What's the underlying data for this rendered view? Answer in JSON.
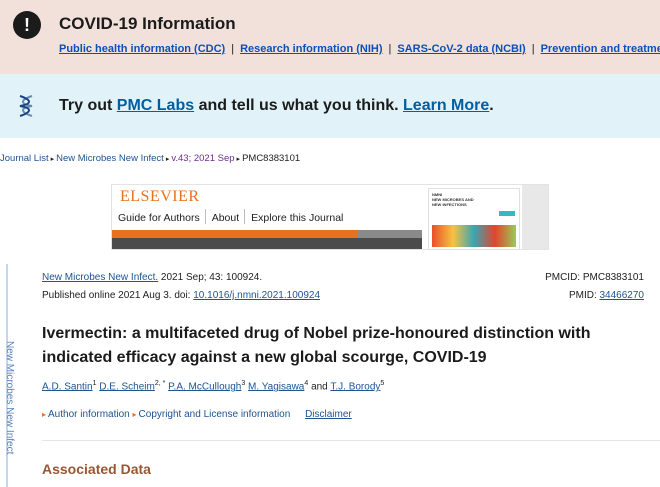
{
  "covid": {
    "title": "COVID-19 Information",
    "links": [
      "Public health information (CDC)",
      "Research information (NIH)",
      "SARS-CoV-2 data (NCBI)",
      "Prevention and treatment"
    ],
    "separator": "|"
  },
  "labs": {
    "prefix": "Try out ",
    "link": "PMC Labs",
    "middle": " and tell us what you think. ",
    "learn_more": "Learn More",
    "suffix": "."
  },
  "breadcrumb": {
    "items": [
      "Journal List",
      "New Microbes New Infect",
      "v.43; 2021 Sep",
      "PMC8383101"
    ]
  },
  "journal_banner": {
    "publisher": "ELSEVIER",
    "nav": [
      "Guide for Authors",
      "About",
      "Explore this Journal"
    ],
    "cover_text": "NMNI\nNEW MICROBES AND\nNEW INFECTIONS"
  },
  "side_tab": "New Microbes New Infect",
  "article": {
    "journal_link": "New Microbes New Infect.",
    "citation": " 2021 Sep; 43: 100924.",
    "published": "Published online 2021 Aug 3. doi: ",
    "doi": "10.1016/j.nmni.2021.100924",
    "pmcid": "PMCID: PMC8383101",
    "pmid_label": "PMID: ",
    "pmid": "34466270",
    "title": "Ivermectin: a multifaceted drug of Nobel prize-honoured distinction with indicated efficacy against a new global scourge, COVID-19",
    "authors": [
      {
        "name": "A.D. Santin",
        "sup": "1"
      },
      {
        "name": "D.E. Scheim",
        "sup": "2, *"
      },
      {
        "name": "P.A. McCullough",
        "sup": "3"
      },
      {
        "name": "M. Yagisawa",
        "sup": "4"
      },
      {
        "name": "T.J. Borody",
        "sup": "5"
      }
    ],
    "info_links": [
      "Author information",
      "Copyright and License information"
    ],
    "disclaimer": "Disclaimer"
  },
  "associated_data": "Associated Data",
  "colors": {
    "covid_bg": "#f2e1da",
    "labs_bg": "#e1f3f8",
    "link": "#205493",
    "accent_orange": "#e9711c",
    "section_heading": "#985735"
  }
}
